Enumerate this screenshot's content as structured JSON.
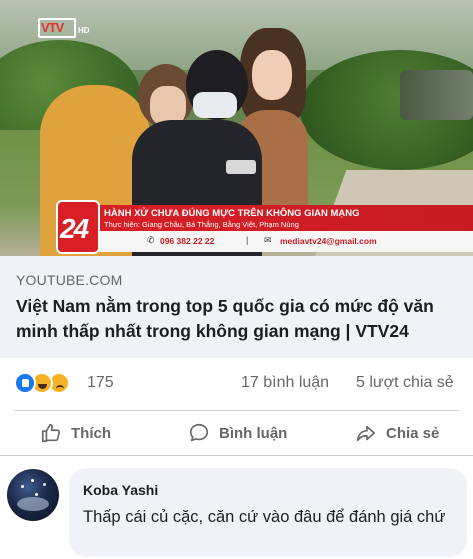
{
  "video": {
    "channel_logo": "VTV",
    "channel_logo_suffix": "HD",
    "lower_third": {
      "logo": "24",
      "headline": "HÀNH XỬ CHƯA ĐÚNG MỰC TRÊN KHÔNG GIAN MẠNG",
      "credits": "Thực hiện: Giang Châu, Bá Thắng, Bằng Việt, Phạm Nùng",
      "phone": "096 382 22 22",
      "separator": "|",
      "email": "mediavtv24@gmail.com",
      "phone_icon": "phone-icon",
      "email_icon": "mail-icon",
      "accent_color": "#d81f26"
    }
  },
  "link_preview": {
    "source": "YOUTUBE.COM",
    "title": "Việt Nam nằm trong top 5 quốc gia có mức độ văn minh thấp nhất trong không gian mạng | VTV24"
  },
  "engagement": {
    "reaction_icons": [
      "like-icon",
      "haha-icon",
      "sad-icon"
    ],
    "reaction_count": "175",
    "comment_count": "17 bình luận",
    "share_count": "5 lượt chia sẻ"
  },
  "actions": {
    "like_label": "Thích",
    "comment_label": "Bình luận",
    "share_label": "Chia sẻ"
  },
  "comment": {
    "author": "Koba Yashi",
    "text": "Thấp cái củ cặc, căn cứ vào đâu để đánh giá chứ"
  },
  "colors": {
    "background": "#ffffff",
    "caption_bg": "#f0f2f5",
    "secondary_text": "#65676b",
    "like_blue": "#1877f2",
    "reaction_yellow": "#f7b125"
  }
}
